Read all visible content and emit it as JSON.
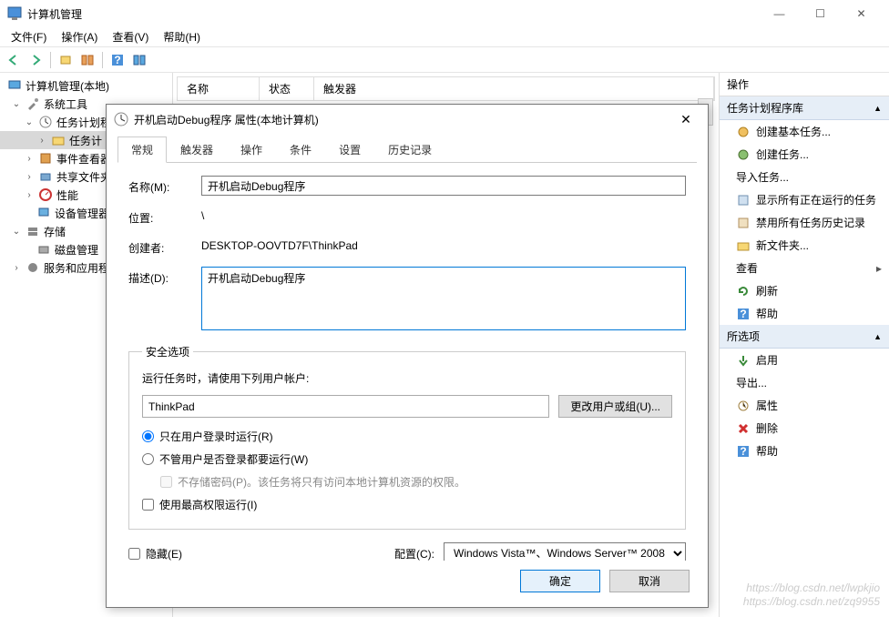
{
  "window": {
    "title": "计算机管理",
    "menus": [
      "文件(F)",
      "操作(A)",
      "查看(V)",
      "帮助(H)"
    ],
    "winbtns": {
      "min": "—",
      "max": "☐",
      "close": "✕"
    }
  },
  "tree": {
    "root": "计算机管理(本地)",
    "systools": "系统工具",
    "sched": "任务计划程",
    "schedlib": "任务计",
    "eventvwr": "事件查看器",
    "sharedf": "共享文件夹",
    "perf": "性能",
    "devmgr": "设备管理器",
    "storage": "存储",
    "diskmgr": "磁盘管理",
    "services": "服务和应用程"
  },
  "listcols": {
    "name": "名称",
    "status": "状态",
    "triggers": "触发器"
  },
  "actions": {
    "header": "操作",
    "group1": "任务计划程序库",
    "items1": [
      "创建基本任务...",
      "创建任务...",
      "导入任务...",
      "显示所有正在运行的任务",
      "禁用所有任务历史记录",
      "新文件夹...",
      "查看",
      "刷新",
      "帮助"
    ],
    "group2": "所选项",
    "items2": [
      "启用",
      "导出...",
      "属性",
      "删除",
      "帮助"
    ]
  },
  "dialog": {
    "title": "开机启动Debug程序 属性(本地计算机)",
    "close_x": "✕",
    "tabs": [
      "常规",
      "触发器",
      "操作",
      "条件",
      "设置",
      "历史记录"
    ],
    "lbl_name": "名称(M):",
    "val_name": "开机启动Debug程序",
    "lbl_location": "位置:",
    "val_location": "\\",
    "lbl_creator": "创建者:",
    "val_creator": "DESKTOP-OOVTD7F\\ThinkPad",
    "lbl_desc": "描述(D):",
    "val_desc": "开机启动Debug程序",
    "sec_legend": "安全选项",
    "sec_runastxt": "运行任务时，请使用下列用户帐户:",
    "sec_user": "ThinkPad",
    "sec_changeuser": "更改用户或组(U)...",
    "sec_radio1": "只在用户登录时运行(R)",
    "sec_radio2": "不管用户是否登录都要运行(W)",
    "sec_chk_nopw": "不存储密码(P)。该任务将只有访问本地计算机资源的权限。",
    "sec_chk_highest": "使用最高权限运行(I)",
    "chk_hidden": "隐藏(E)",
    "lbl_config": "配置(C):",
    "val_config": "Windows Vista™、Windows Server™ 2008",
    "btn_ok": "确定",
    "btn_cancel": "取消"
  },
  "watermark": {
    "l1": "https://blog.csdn.net/lwpkjio",
    "l2": "https://blog.csdn.net/zq9955"
  }
}
